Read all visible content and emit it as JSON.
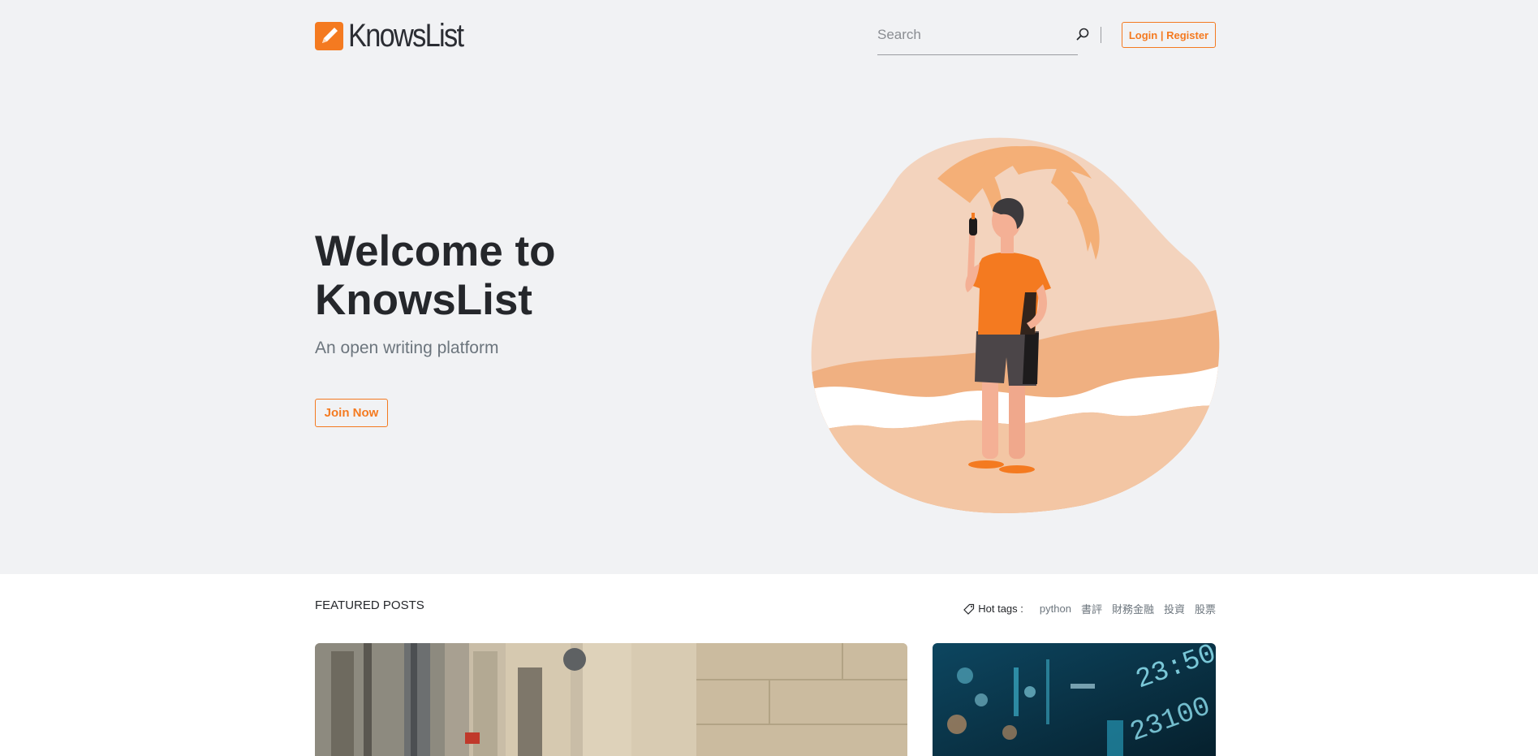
{
  "header": {
    "logo_text": "KnowsList",
    "search_placeholder": "Search",
    "login_label": "Login | Register"
  },
  "hero": {
    "title": "Welcome to KnowsList",
    "subtitle": "An open writing platform",
    "cta_label": "Join Now"
  },
  "featured": {
    "label": "FEATURED POSTS",
    "hot_tags_label": "Hot tags :",
    "tags": [
      "python",
      "書評",
      "財務金融",
      "投資",
      "股票"
    ]
  },
  "colors": {
    "accent": "#f47a20",
    "hero_bg": "#f1f2f4",
    "text_dark": "#25272b",
    "text_muted": "#6c757d"
  },
  "icons": {
    "logo": "pencil-icon",
    "search": "search-icon",
    "tags": "tag-icon"
  }
}
